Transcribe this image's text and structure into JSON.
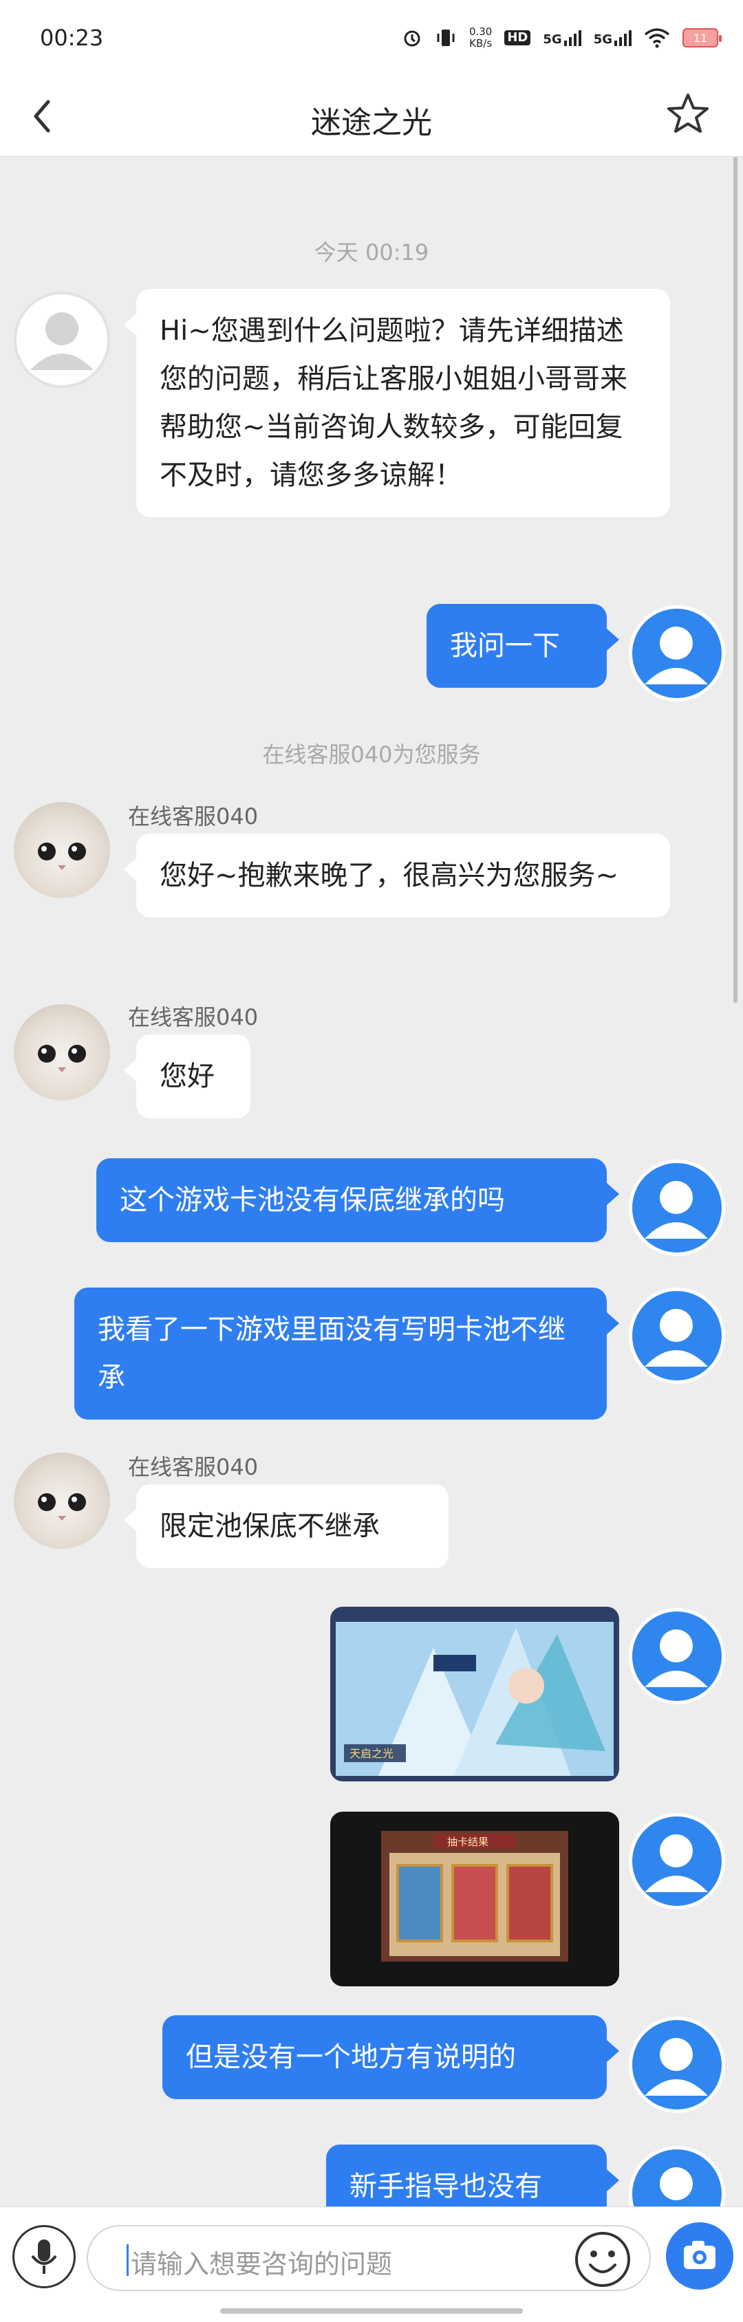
{
  "status_bar": {
    "time": "00:23",
    "speed_value": "0.30",
    "speed_unit": "KB/s",
    "hd_label": "HD",
    "net1": "5G",
    "net2": "5G",
    "battery": "11"
  },
  "header": {
    "back_icon": "chevron-left-icon",
    "title": "迷途之光",
    "favorite_icon": "star-outline-icon"
  },
  "chat": {
    "timestamp": "今天 00:19",
    "system_notice": "在线客服040为您服务",
    "agent_name": "在线客服040",
    "messages": [
      {
        "side": "left",
        "avatar": "default-avatar",
        "text": "Hi~您遇到什么问题啦？请先详细描述您的问题，稍后让客服小姐姐小哥哥来帮助您~当前咨询人数较多，可能回复不及时，请您多多谅解！"
      },
      {
        "side": "right",
        "avatar": "user-avatar",
        "text": "我问一下"
      },
      {
        "side": "left",
        "avatar": "cat-avatar",
        "sender": "在线客服040",
        "text": "您好~抱歉来晚了，很高兴为您服务~"
      },
      {
        "side": "left",
        "avatar": "cat-avatar",
        "sender": "在线客服040",
        "text": "您好"
      },
      {
        "side": "right",
        "avatar": "user-avatar",
        "text": "这个游戏卡池没有保底继承的吗"
      },
      {
        "side": "right",
        "avatar": "user-avatar",
        "text": "我看了一下游戏里面没有写明卡池不继承"
      },
      {
        "side": "left",
        "avatar": "cat-avatar",
        "sender": "在线客服040",
        "text": "限定池保底不继承"
      },
      {
        "side": "right",
        "avatar": "user-avatar",
        "type": "image",
        "image_label": "天启之光"
      },
      {
        "side": "right",
        "avatar": "user-avatar",
        "type": "image",
        "image_label": "抽卡结果"
      },
      {
        "side": "right",
        "avatar": "user-avatar",
        "text": "但是没有一个地方有说明的"
      },
      {
        "side": "right",
        "avatar": "user-avatar",
        "text": "新手指导也没有"
      }
    ]
  },
  "input_bar": {
    "mic_icon": "microphone-icon",
    "placeholder": "请输入想要咨询的问题",
    "emoji_icon": "emoji-icon",
    "camera_icon": "camera-icon"
  },
  "colors": {
    "accent": "#2f7ef1",
    "background": "#ededed",
    "bubble_left": "#ffffff"
  }
}
